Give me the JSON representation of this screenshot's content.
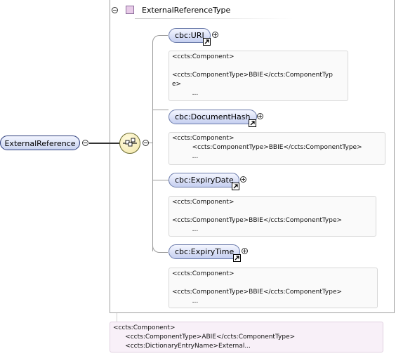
{
  "root": {
    "label": "ExternalReference"
  },
  "type": {
    "title": "ExternalReferenceType"
  },
  "children": [
    {
      "label": "cbc:URI",
      "annotation": {
        "line1": "<ccts:Component>",
        "line2": "<ccts:ComponentType>BBIE</ccts:ComponentTyp",
        "line3": "e>",
        "line4": "..."
      }
    },
    {
      "label": "cbc:DocumentHash",
      "annotation": {
        "line1": "<ccts:Component>",
        "line2": "<ccts:ComponentType>BBIE</ccts:ComponentType>",
        "line3": "..."
      }
    },
    {
      "label": "cbc:ExpiryDate",
      "annotation": {
        "line1": "<ccts:Component>",
        "line2": "<ccts:ComponentType>BBIE</ccts:ComponentType>",
        "line3": "..."
      }
    },
    {
      "label": "cbc:ExpiryTime",
      "annotation": {
        "line1": "<ccts:Component>",
        "line2": "<ccts:ComponentType>BBIE</ccts:ComponentType>",
        "line3": "..."
      }
    }
  ],
  "type_annotation": {
    "line1": "<ccts:Component>",
    "line2": "<ccts:ComponentType>ABIE</ccts:ComponentType>",
    "line3": "<ccts:DictionaryEntryName>External..."
  },
  "icons": {
    "collapse": "minus-circle-icon",
    "expand": "plus-circle-icon",
    "reference": "reference-arrow-icon",
    "sequence": "sequence-compositor-icon",
    "complex_type": "complex-type-icon"
  }
}
